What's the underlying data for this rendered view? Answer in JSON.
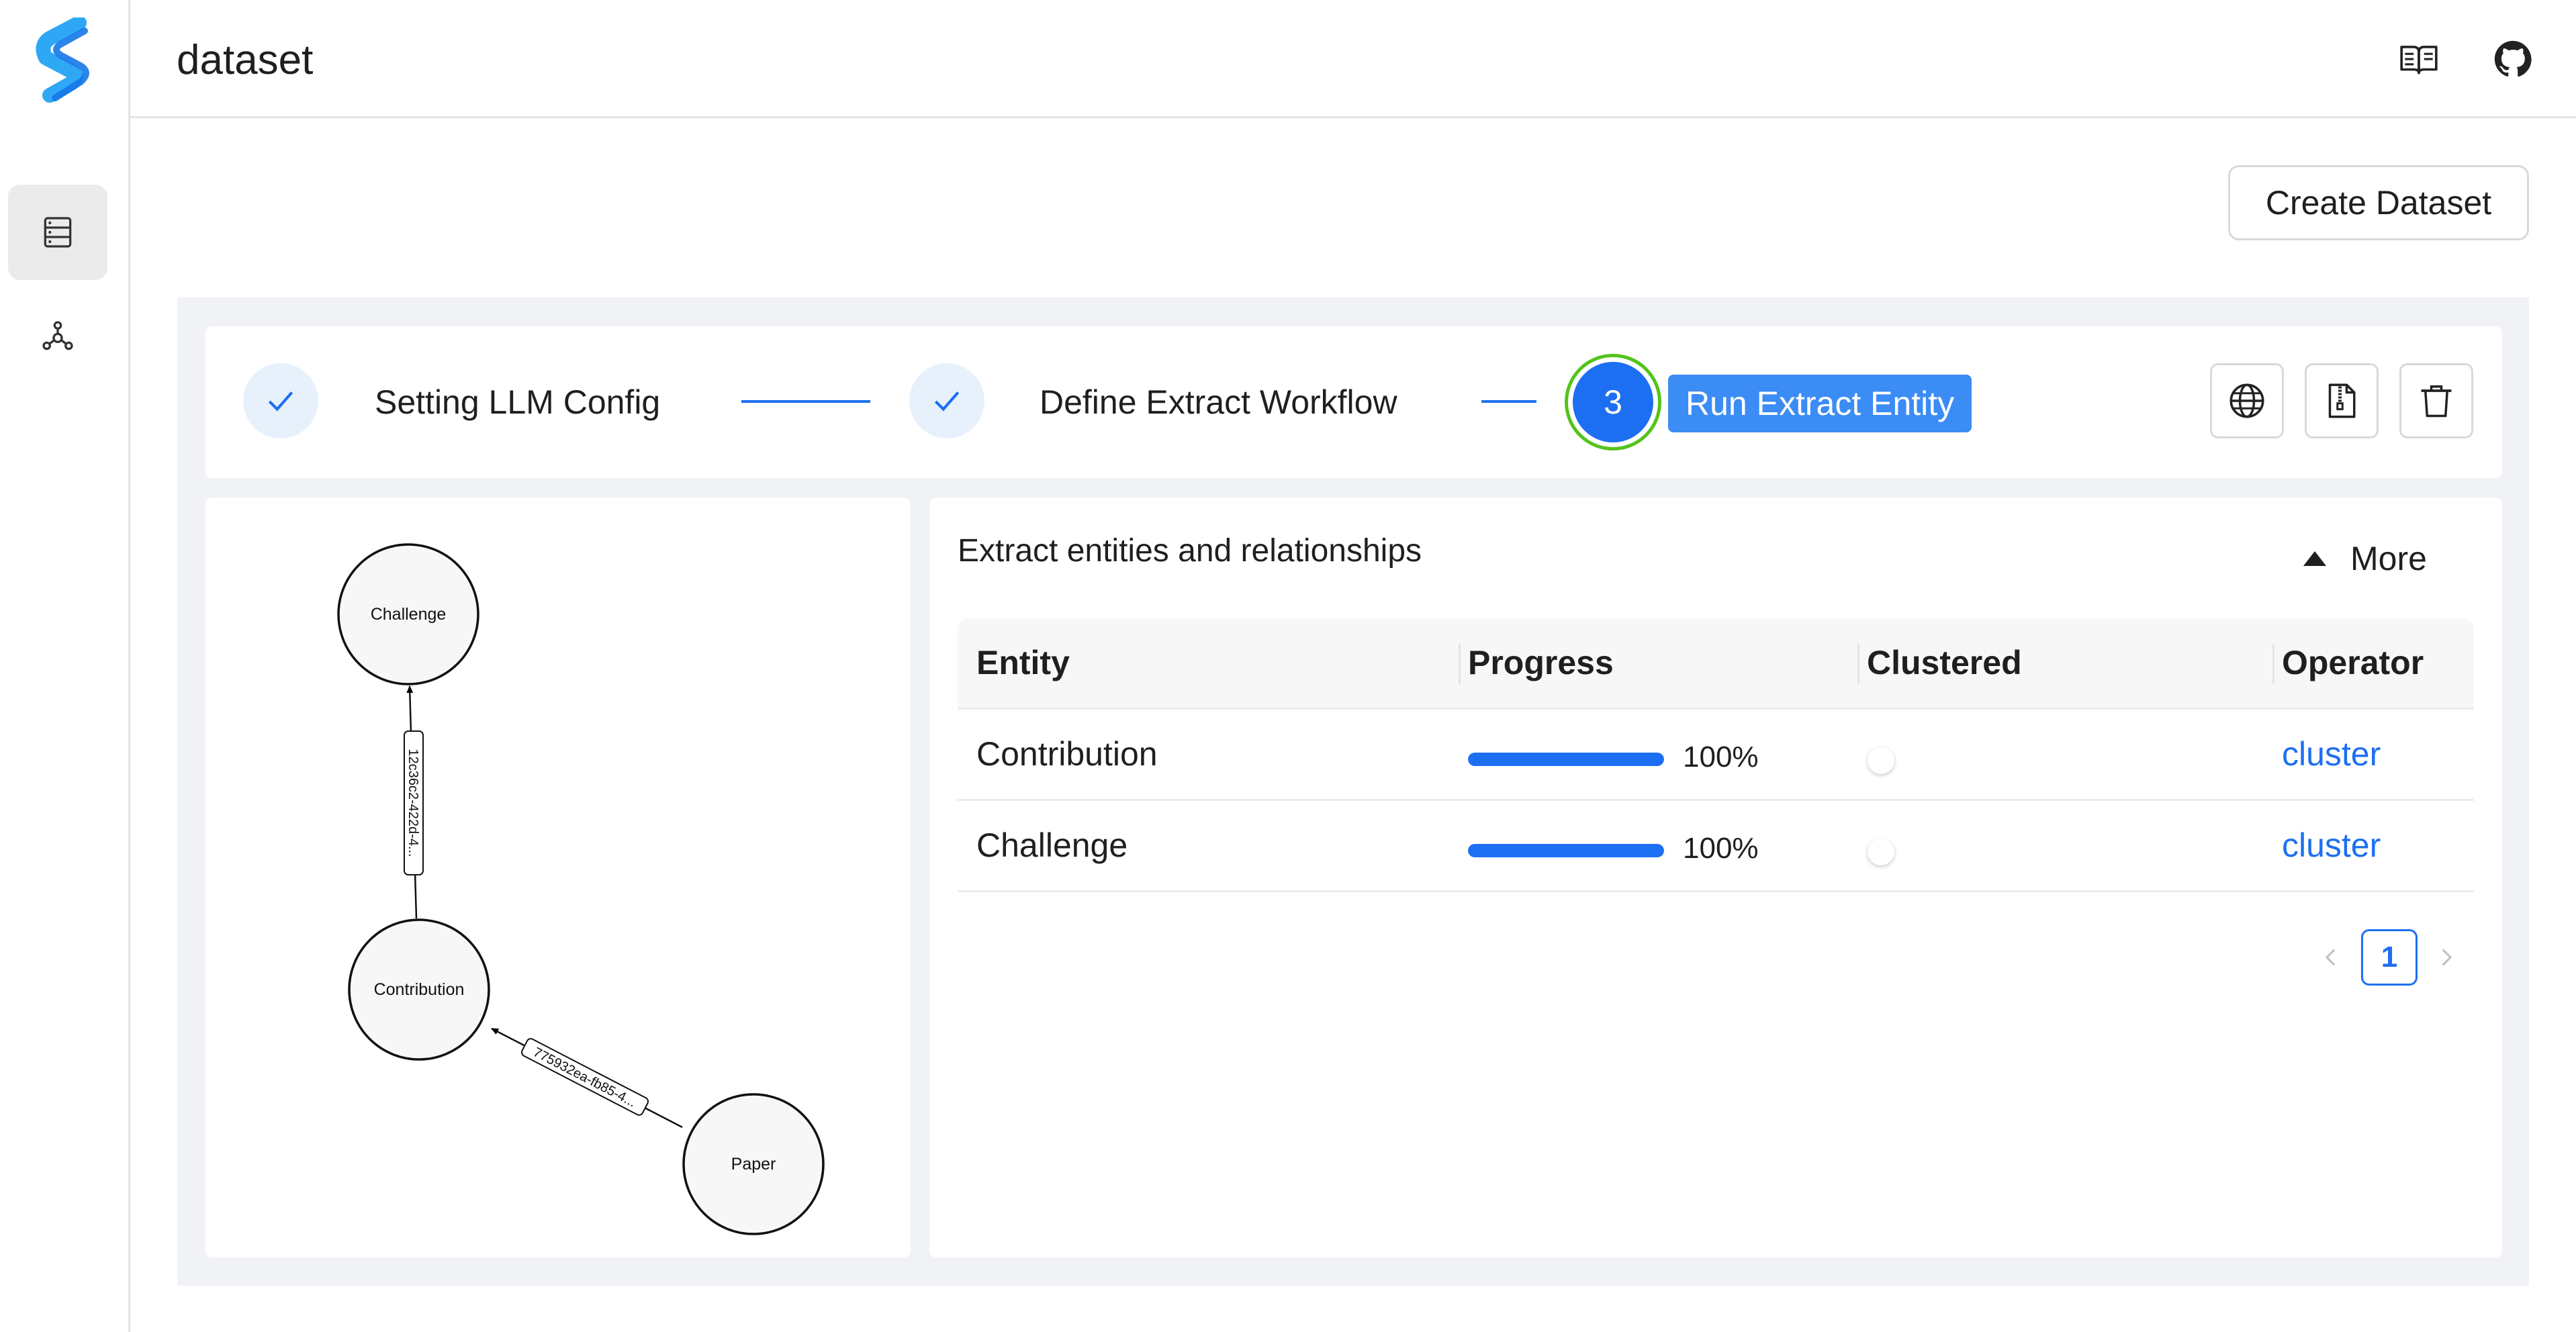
{
  "header": {
    "title": "dataset",
    "icons": [
      "book-open-icon",
      "github-icon"
    ]
  },
  "sidebar": {
    "items": [
      {
        "icon": "database-icon",
        "active": true
      },
      {
        "icon": "graph-nodes-icon",
        "active": false
      }
    ]
  },
  "actions": {
    "create_dataset": "Create Dataset"
  },
  "steps": [
    {
      "label": "Setting LLM Config",
      "status": "finished"
    },
    {
      "label": "Define Extract Workflow",
      "status": "finished"
    },
    {
      "number": "3",
      "label": "Run Extract Entity",
      "status": "current"
    }
  ],
  "toolbar": {
    "icons": [
      "globe-icon",
      "file-zip-icon",
      "trash-icon"
    ]
  },
  "graph": {
    "nodes": [
      {
        "label": "Challenge"
      },
      {
        "label": "Contribution"
      },
      {
        "label": "Paper"
      }
    ],
    "edges": [
      {
        "from": "Contribution",
        "to": "Challenge",
        "label": "12c36c2-422d-4..."
      },
      {
        "from": "Paper",
        "to": "Contribution",
        "label": "775932ea-fb85-4..."
      }
    ]
  },
  "extract": {
    "title": "Extract entities and relationships",
    "more_label": "More",
    "columns": [
      "Entity",
      "Progress",
      "Clustered",
      "Operator"
    ],
    "rows": [
      {
        "entity": "Contribution",
        "progress": 100,
        "progress_label": "100%",
        "clustered": false,
        "operator": "cluster"
      },
      {
        "entity": "Challenge",
        "progress": 100,
        "progress_label": "100%",
        "clustered": false,
        "operator": "cluster"
      }
    ],
    "pagination": {
      "current": "1"
    }
  },
  "colors": {
    "primary": "#1d6ff2",
    "step_label_bg": "#3b8cf5",
    "success_ring": "#52c41a",
    "panel_bg": "#f0f2f5"
  }
}
